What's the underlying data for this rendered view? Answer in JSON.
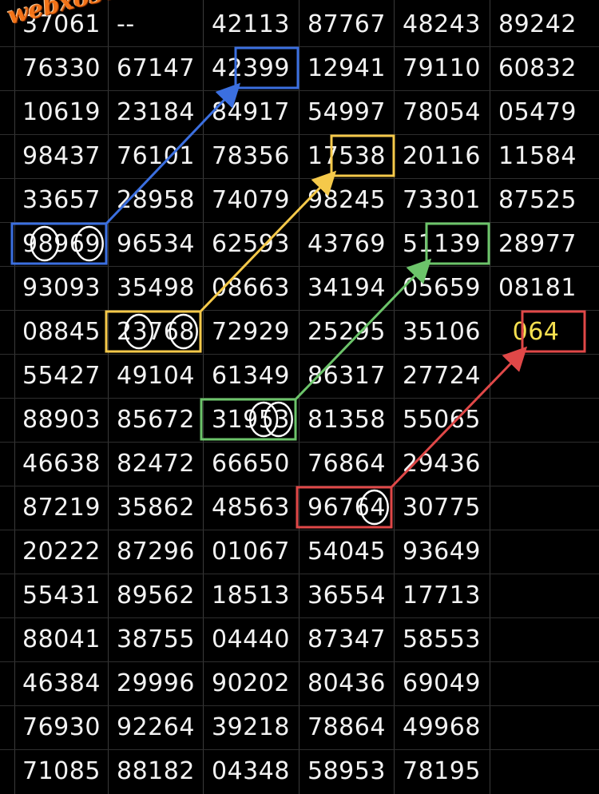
{
  "watermark": "webxoso.net",
  "rows": [
    [
      "37061",
      "--",
      "42113",
      "87767",
      "48243",
      "89242"
    ],
    [
      "76330",
      "67147",
      "42399",
      "12941",
      "79110",
      "60832"
    ],
    [
      "10619",
      "23184",
      "84917",
      "54997",
      "78054",
      "05479"
    ],
    [
      "98437",
      "76101",
      "78356",
      "17538",
      "20116",
      "11584"
    ],
    [
      "33657",
      "28958",
      "74079",
      "98245",
      "73301",
      "87525"
    ],
    [
      "98969",
      "96534",
      "62593",
      "43769",
      "51139",
      "28977"
    ],
    [
      "93093",
      "35498",
      "08663",
      "34194",
      "05659",
      "08181"
    ],
    [
      "08845",
      "23768",
      "72929",
      "25295",
      "35106",
      "064"
    ],
    [
      "55427",
      "49104",
      "61349",
      "86317",
      "27724",
      ""
    ],
    [
      "88903",
      "85672",
      "31953",
      "81358",
      "55065",
      ""
    ],
    [
      "46638",
      "82472",
      "66650",
      "76864",
      "29436",
      ""
    ],
    [
      "87219",
      "35862",
      "48563",
      "96764",
      "30775",
      ""
    ],
    [
      "20222",
      "87296",
      "01067",
      "54045",
      "93649",
      ""
    ],
    [
      "55431",
      "89562",
      "18513",
      "36554",
      "17713",
      ""
    ],
    [
      "88041",
      "38755",
      "04440",
      "87347",
      "58553",
      ""
    ],
    [
      "46384",
      "29996",
      "90202",
      "80436",
      "69049",
      ""
    ],
    [
      "76930",
      "92264",
      "39218",
      "78864",
      "49968",
      ""
    ],
    [
      "71085",
      "88182",
      "04348",
      "58953",
      "78195",
      ""
    ]
  ],
  "highlight_value": {
    "row": 7,
    "col": 5,
    "color": "#f5e050"
  },
  "highlights": [
    {
      "color": "#3b6fe0",
      "from": {
        "row": 5,
        "col": 0
      },
      "to": {
        "row": 1,
        "col": 2
      },
      "circled_digits": [
        1,
        4
      ]
    },
    {
      "color": "#f5c94a",
      "from": {
        "row": 7,
        "col": 1
      },
      "to": {
        "row": 3,
        "col": 3
      },
      "circled_digits": [
        1,
        4
      ]
    },
    {
      "color": "#6cc46a",
      "from": {
        "row": 9,
        "col": 2
      },
      "to": {
        "row": 5,
        "col": 4
      },
      "circled_digits": [
        3,
        4
      ]
    },
    {
      "color": "#e04848",
      "from": {
        "row": 11,
        "col": 3
      },
      "to": {
        "row": 7,
        "col": 5
      },
      "circled_digits": [
        4
      ]
    }
  ]
}
